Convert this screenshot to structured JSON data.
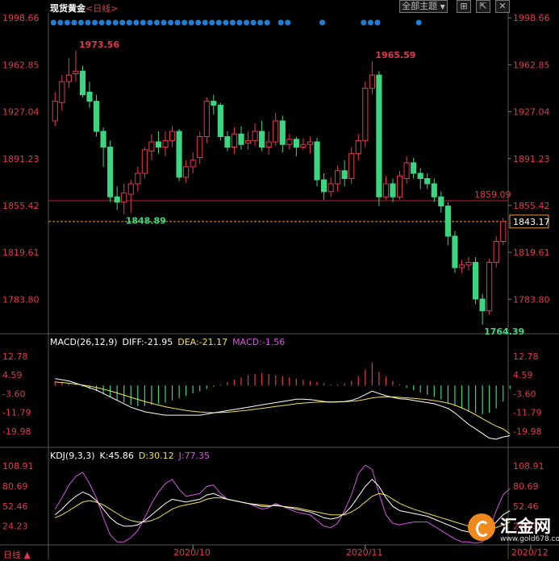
{
  "header": {
    "title": "现货黄金",
    "timeframe": "<日线>",
    "theme_button": "全部主题",
    "theme_arrow": "▼"
  },
  "bottom_left": "日线 ▲",
  "logo": {
    "brand": "汇金网",
    "url": "www.gold678.com"
  },
  "colors": {
    "up": "#e8384f",
    "down": "#3dd680",
    "axis_text": "#e03a4a",
    "macd_line": "#ffffff",
    "signal_line": "#f3e24a",
    "j_line": "#d455e0",
    "dot": "#1e7fd6"
  },
  "macd": {
    "title": "MACD(26,12,9)",
    "diff": "DIFF:-21.95",
    "dea": "DEA:-21.17",
    "macd": "MACD:-1.56"
  },
  "kdj": {
    "title": "KDJ(9,3,3)",
    "k": "K:45.86",
    "d": "D:30.12",
    "j": "J:77.35"
  },
  "chart_data": [
    {
      "type": "candlestick",
      "title": "现货黄金 <日线>",
      "y_ticks": [
        1998.66,
        1962.85,
        1927.04,
        1891.23,
        1855.42,
        1819.61,
        1783.8
      ],
      "ylim": [
        1760,
        2000
      ],
      "x_tick_labels": [
        "2020/10",
        "2020/11",
        "2020/12"
      ],
      "x_tick_index": [
        20,
        45,
        69
      ],
      "annotations": {
        "high": "1973.56",
        "high_2": "1965.59",
        "low": "1848.89",
        "low_2": "1764.39"
      },
      "horizontal_line": {
        "value": 1859.09,
        "label": "1859.09"
      },
      "last_price": {
        "value": 1843.17,
        "label": "1843.17"
      },
      "candles": [
        [
          1920,
          1935,
          1916,
          1942
        ],
        [
          1934,
          1950,
          1928,
          1955
        ],
        [
          1950,
          1955,
          1945,
          1968
        ],
        [
          1956,
          1958,
          1950,
          1973.56
        ],
        [
          1958,
          1940,
          1938,
          1962
        ],
        [
          1942,
          1935,
          1930,
          1950
        ],
        [
          1935,
          1912,
          1908,
          1940
        ],
        [
          1912,
          1900,
          1885,
          1915
        ],
        [
          1900,
          1862,
          1858,
          1905
        ],
        [
          1862,
          1858,
          1852,
          1870
        ],
        [
          1858,
          1865,
          1848.89,
          1872
        ],
        [
          1864,
          1872,
          1850,
          1875
        ],
        [
          1872,
          1880,
          1866,
          1885
        ],
        [
          1880,
          1898,
          1876,
          1900
        ],
        [
          1897,
          1904,
          1890,
          1910
        ],
        [
          1904,
          1900,
          1895,
          1912
        ],
        [
          1900,
          1905,
          1893,
          1912
        ],
        [
          1905,
          1912,
          1900,
          1916
        ],
        [
          1912,
          1877,
          1874,
          1914
        ],
        [
          1877,
          1885,
          1873,
          1890
        ],
        [
          1885,
          1890,
          1880,
          1896
        ],
        [
          1892,
          1908,
          1887,
          1912
        ],
        [
          1908,
          1935,
          1903,
          1938
        ],
        [
          1935,
          1932,
          1925,
          1940
        ],
        [
          1932,
          1908,
          1905,
          1934
        ],
        [
          1908,
          1900,
          1897,
          1912
        ],
        [
          1900,
          1910,
          1895,
          1915
        ],
        [
          1910,
          1902,
          1898,
          1916
        ],
        [
          1903,
          1905,
          1898,
          1912
        ],
        [
          1905,
          1912,
          1901,
          1918
        ],
        [
          1912,
          1900,
          1897,
          1920
        ],
        [
          1900,
          1904,
          1894,
          1912
        ],
        [
          1904,
          1920,
          1901,
          1926
        ],
        [
          1920,
          1902,
          1896,
          1924
        ],
        [
          1902,
          1906,
          1898,
          1910
        ],
        [
          1906,
          1900,
          1893,
          1908
        ],
        [
          1900,
          1902,
          1898,
          1907
        ],
        [
          1902,
          1904,
          1895,
          1908
        ],
        [
          1904,
          1875,
          1870,
          1907
        ],
        [
          1875,
          1866,
          1860,
          1880
        ],
        [
          1866,
          1872,
          1862,
          1877
        ],
        [
          1872,
          1882,
          1866,
          1886
        ],
        [
          1882,
          1876,
          1870,
          1890
        ],
        [
          1876,
          1895,
          1872,
          1900
        ],
        [
          1895,
          1905,
          1890,
          1910
        ],
        [
          1905,
          1945,
          1900,
          1950
        ],
        [
          1945,
          1955,
          1940,
          1965.59
        ],
        [
          1955,
          1862,
          1855,
          1958
        ],
        [
          1862,
          1872,
          1860,
          1878
        ],
        [
          1872,
          1862,
          1858,
          1876
        ],
        [
          1862,
          1878,
          1860,
          1882
        ],
        [
          1876,
          1888,
          1872,
          1893
        ],
        [
          1888,
          1880,
          1876,
          1892
        ],
        [
          1880,
          1876,
          1868,
          1884
        ],
        [
          1876,
          1872,
          1868,
          1880
        ],
        [
          1872,
          1862,
          1858,
          1876
        ],
        [
          1862,
          1855,
          1850,
          1866
        ],
        [
          1855,
          1832,
          1825,
          1858
        ],
        [
          1832,
          1808,
          1804,
          1836
        ],
        [
          1808,
          1810,
          1804,
          1814
        ],
        [
          1810,
          1812,
          1806,
          1816
        ],
        [
          1812,
          1784,
          1780,
          1816
        ],
        [
          1784,
          1775,
          1764.39,
          1788
        ],
        [
          1775,
          1812,
          1772,
          1815
        ],
        [
          1812,
          1828,
          1808,
          1832
        ],
        [
          1828,
          1843.17,
          1825,
          1846
        ]
      ]
    },
    {
      "type": "macd",
      "title": "MACD(26,12,9)",
      "y_ticks": [
        12.78,
        4.59,
        -3.6,
        -11.79,
        -19.98
      ],
      "ylim": [
        -26,
        17
      ],
      "diff": [
        3,
        2.5,
        2,
        1,
        0,
        -1,
        -2,
        -3.5,
        -5,
        -6.5,
        -8,
        -9.5,
        -10.5,
        -11.5,
        -12,
        -12.5,
        -13,
        -13,
        -13,
        -13,
        -13,
        -13,
        -12.5,
        -12,
        -11.5,
        -11,
        -10.5,
        -10,
        -9.5,
        -9,
        -8.5,
        -8,
        -7.5,
        -7,
        -6.5,
        -6,
        -6,
        -6.2,
        -6.5,
        -7,
        -7.3,
        -7.2,
        -7,
        -6.5,
        -5.5,
        -4,
        -2.5,
        -3.5,
        -4.5,
        -5.2,
        -5.8,
        -6,
        -6.5,
        -7,
        -7.5,
        -8,
        -9,
        -10,
        -12,
        -14.5,
        -17,
        -19,
        -21,
        -23,
        -23.5,
        -22.5,
        -21.95
      ],
      "dea": [
        1.5,
        1.3,
        1,
        0.6,
        0.2,
        -0.3,
        -0.9,
        -1.6,
        -2.4,
        -3.3,
        -4.2,
        -5.2,
        -6.1,
        -7,
        -7.8,
        -8.6,
        -9.3,
        -9.9,
        -10.4,
        -10.9,
        -11.3,
        -11.6,
        -11.8,
        -11.9,
        -11.8,
        -11.7,
        -11.4,
        -11.1,
        -10.8,
        -10.4,
        -10,
        -9.6,
        -9.2,
        -8.8,
        -8.4,
        -8,
        -7.7,
        -7.5,
        -7.3,
        -7.2,
        -7.2,
        -7.1,
        -7.1,
        -6.9,
        -6.6,
        -6.1,
        -5.4,
        -5.1,
        -5,
        -5,
        -5.2,
        -5.4,
        -5.6,
        -5.9,
        -6.2,
        -6.6,
        -7.1,
        -7.7,
        -8.6,
        -9.8,
        -11.2,
        -12.8,
        -14.5,
        -16.2,
        -17.8,
        -19,
        -21.17
      ],
      "histogram": [
        2,
        1.5,
        1,
        0.5,
        -0.5,
        -1.5,
        -2.5,
        -3.5,
        -5,
        -6.5,
        -7.5,
        -8.5,
        -9,
        -9,
        -8.5,
        -8,
        -7.5,
        -6.5,
        -5.5,
        -4.5,
        -3.5,
        -2.5,
        -1.5,
        -0.5,
        0.5,
        1.5,
        2.5,
        3.5,
        4.5,
        5,
        5.5,
        5,
        4.5,
        4,
        3.5,
        3,
        2.5,
        2,
        1.5,
        1,
        0.5,
        0.5,
        1,
        2,
        4,
        7,
        10,
        6,
        4,
        2,
        0.5,
        -1,
        -2,
        -3,
        -4,
        -5,
        -6,
        -7.5,
        -9,
        -10,
        -11,
        -12,
        -12.5,
        -12,
        -10,
        -7,
        -1.56
      ]
    },
    {
      "type": "kdj",
      "title": "KDJ(9,3,3)",
      "y_ticks": [
        108.91,
        80.69,
        52.46,
        24.23
      ],
      "ylim": [
        0,
        118
      ],
      "k": [
        40,
        48,
        58,
        66,
        72,
        68,
        60,
        48,
        36,
        28,
        24,
        24,
        26,
        32,
        40,
        48,
        56,
        62,
        60,
        58,
        60,
        62,
        68,
        70,
        66,
        62,
        60,
        58,
        56,
        54,
        52,
        52,
        54,
        52,
        50,
        48,
        46,
        44,
        40,
        36,
        34,
        36,
        42,
        52,
        66,
        80,
        90,
        80,
        64,
        52,
        46,
        44,
        42,
        40,
        38,
        34,
        30,
        26,
        22,
        18,
        16,
        14,
        12,
        20,
        30,
        40,
        45.86
      ],
      "d": [
        36,
        40,
        46,
        52,
        58,
        60,
        58,
        54,
        48,
        42,
        36,
        32,
        30,
        30,
        32,
        36,
        42,
        48,
        52,
        54,
        56,
        58,
        62,
        64,
        64,
        62,
        60,
        58,
        56,
        55,
        54,
        53,
        53,
        52,
        51,
        50,
        48,
        46,
        44,
        42,
        40,
        40,
        40,
        44,
        50,
        58,
        66,
        70,
        68,
        62,
        56,
        52,
        48,
        45,
        42,
        39,
        36,
        33,
        30,
        27,
        24,
        22,
        20,
        20,
        22,
        26,
        30.12
      ],
      "j": [
        48,
        64,
        82,
        94,
        100,
        84,
        64,
        36,
        12,
        2,
        2,
        8,
        18,
        36,
        56,
        72,
        84,
        90,
        76,
        66,
        68,
        70,
        80,
        82,
        70,
        62,
        60,
        58,
        56,
        52,
        48,
        50,
        56,
        52,
        48,
        44,
        42,
        40,
        32,
        24,
        22,
        28,
        46,
        68,
        98,
        110,
        104,
        70,
        40,
        28,
        26,
        28,
        30,
        30,
        30,
        24,
        18,
        12,
        6,
        2,
        2,
        0,
        2,
        20,
        46,
        68,
        77.35
      ]
    }
  ]
}
